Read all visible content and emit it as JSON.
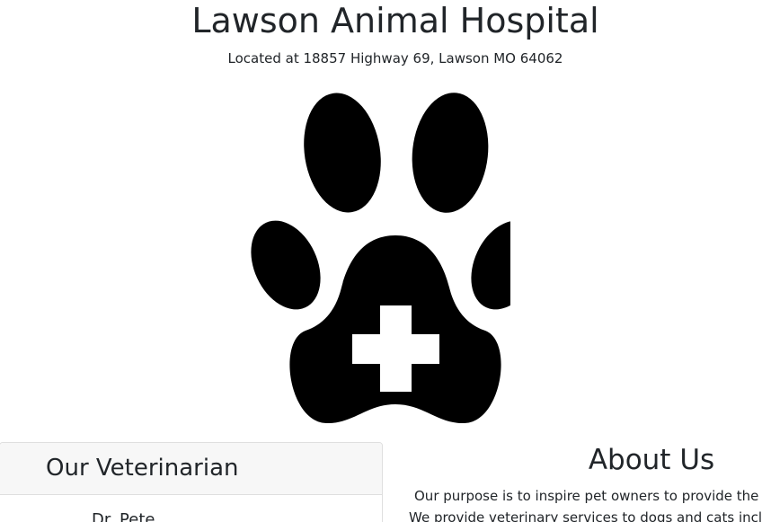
{
  "header": {
    "title": "Lawson Animal Hospital",
    "subtitle": "Located at 18857 Highway 69, Lawson MO 64062"
  },
  "logo": {
    "icon": "paw-cross-icon",
    "color": "#000000",
    "cross_color": "#ffffff"
  },
  "veterinarian": {
    "heading": "Our Veterinarian",
    "name": "Dr. Pete"
  },
  "about": {
    "heading": "About Us",
    "lines": [
      "Our purpose is to inspire pet owners to provide the best",
      "We provide veterinary services to dogs and cats including"
    ]
  }
}
